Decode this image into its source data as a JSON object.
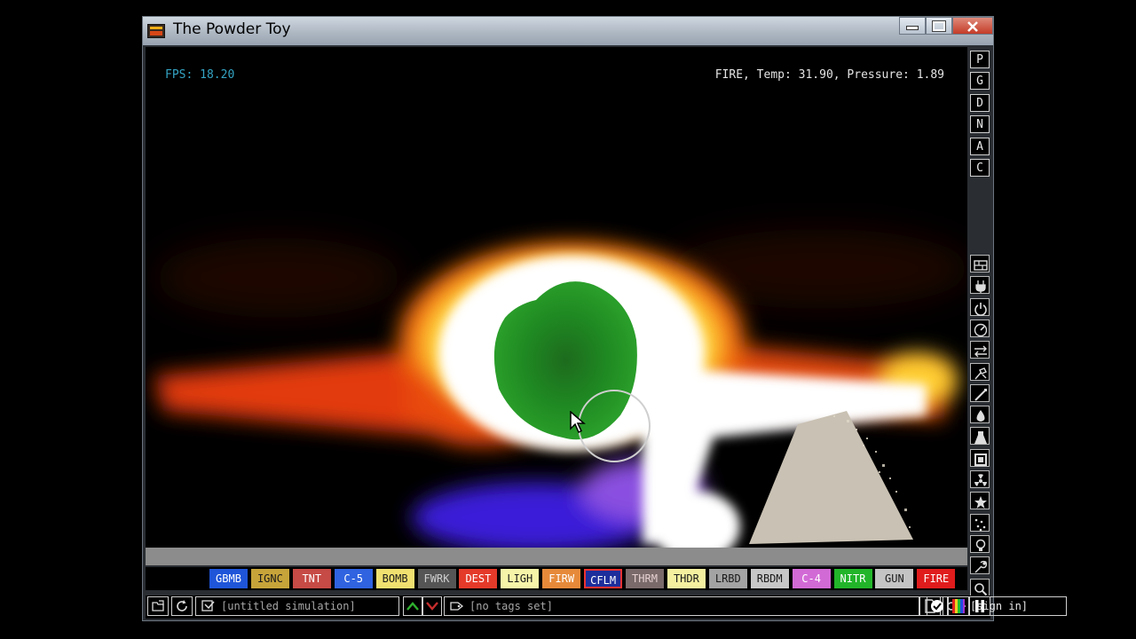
{
  "window": {
    "title": "The Powder Toy"
  },
  "hud": {
    "fps": "FPS: 18.20",
    "status": "FIRE, Temp: 31.90, Pressure: 1.89"
  },
  "mode_buttons": [
    "P",
    "G",
    "D",
    "N",
    "A",
    "C"
  ],
  "category_icons": [
    "walls-icon",
    "electronics-icon",
    "powered-icon",
    "sensors-icon",
    "force-icon",
    "explosives-icon",
    "gases-icon",
    "liquids-icon",
    "powders-icon",
    "solids-icon",
    "radioactive-icon",
    "special-icon",
    "particles-icon",
    "life-icon",
    "tools-icon",
    "search-icon"
  ],
  "elements": [
    {
      "label": "GBMB",
      "bg": "#1f55d8",
      "fg": "#ffffff"
    },
    {
      "label": "IGNC",
      "bg": "#c7a43a",
      "fg": "#1a1a1a"
    },
    {
      "label": "TNT",
      "bg": "#c64a45",
      "fg": "#ffffff"
    },
    {
      "label": "C-5",
      "bg": "#2f63e0",
      "fg": "#ffffff"
    },
    {
      "label": "BOMB",
      "bg": "#f0e070",
      "fg": "#1a1a1a"
    },
    {
      "label": "FWRK",
      "bg": "#555555",
      "fg": "#cfcfcf"
    },
    {
      "label": "DEST",
      "bg": "#e43a2a",
      "fg": "#ffffff"
    },
    {
      "label": "LIGH",
      "bg": "#f6f4a8",
      "fg": "#1a1a1a"
    },
    {
      "label": "FIRW",
      "bg": "#e68a3a",
      "fg": "#ffffff"
    },
    {
      "label": "CFLM",
      "bg": "#1e2e9c",
      "fg": "#ffffff"
    },
    {
      "label": "THRM",
      "bg": "#7a6a6a",
      "fg": "#e6d0d0"
    },
    {
      "label": "THDR",
      "bg": "#f4f0a0",
      "fg": "#1a1a1a"
    },
    {
      "label": "LRBD",
      "bg": "#a3a3a3",
      "fg": "#1a1a1a"
    },
    {
      "label": "RBDM",
      "bg": "#c7c7c7",
      "fg": "#1a1a1a"
    },
    {
      "label": "C-4",
      "bg": "#d26ad6",
      "fg": "#ffffff"
    },
    {
      "label": "NITR",
      "bg": "#22b52a",
      "fg": "#ffffff"
    },
    {
      "label": "GUN",
      "bg": "#c4c4c4",
      "fg": "#1a1a1a"
    },
    {
      "label": "FIRE",
      "bg": "#e01c1c",
      "fg": "#ffffff"
    }
  ],
  "selected_element": "CFLM",
  "bottom": {
    "save_name": "[untitled simulation]",
    "tags": "[no tags set]",
    "sign_in": "[sign in]"
  }
}
